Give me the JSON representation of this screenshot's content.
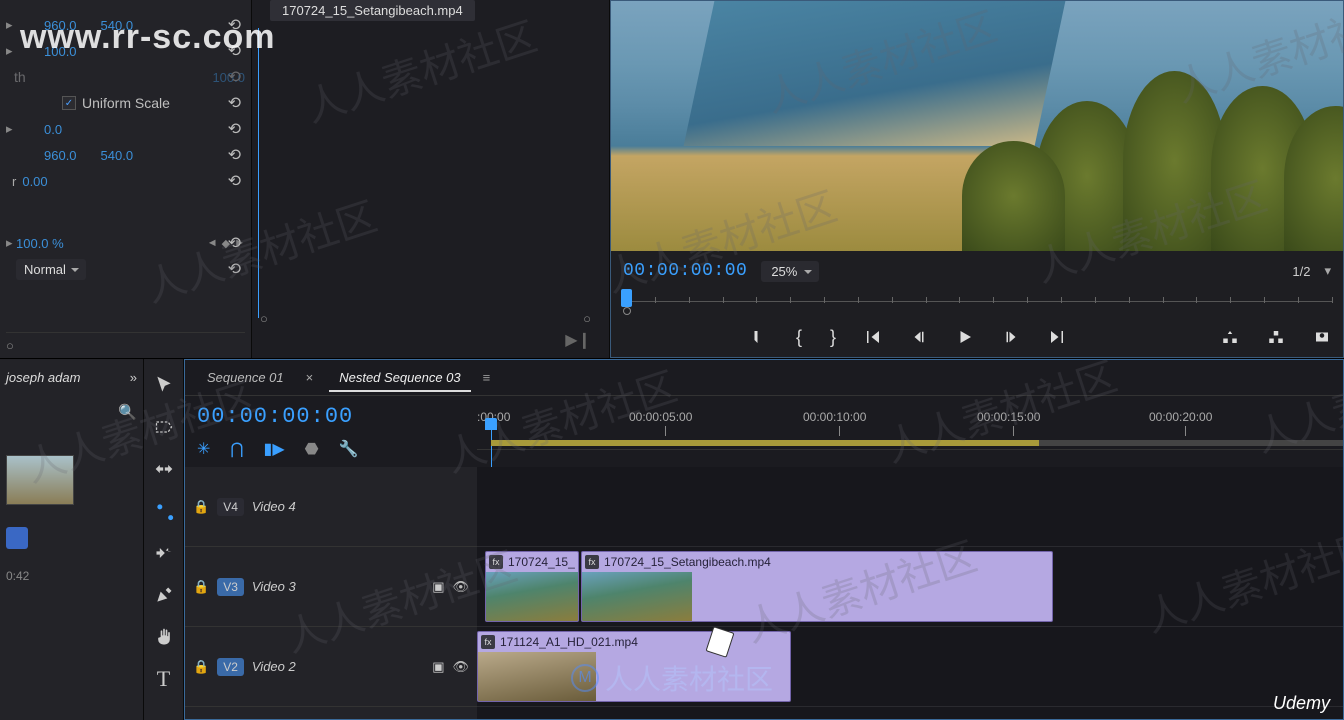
{
  "watermark": {
    "url": "www.rr-sc.com",
    "hanzi": "人人素材社区",
    "udemy": "Udemy"
  },
  "effect_controls": {
    "clip_tab": "170724_15_Setangibeach.mp4",
    "position": {
      "x": "960.0",
      "y": "540.0"
    },
    "scale": "100.0",
    "scale_width": "100.0",
    "uniform_label": "Uniform Scale",
    "rotation": "0.0",
    "anchor": {
      "x": "960.0",
      "y": "540.0"
    },
    "anti_flicker": "0.00",
    "opacity": "100.0 %",
    "blend": "Normal"
  },
  "program": {
    "timecode": "00:00:00:00",
    "zoom": "25%",
    "resolution": "1/2"
  },
  "project": {
    "tab": "joseph adam",
    "meta": "0:42"
  },
  "timeline": {
    "tabs": [
      "Sequence 01",
      "Nested Sequence 03"
    ],
    "active_tab": 1,
    "timecode": "00:00:00:00",
    "ruler": [
      ":00:00",
      "00:00:05:00",
      "00:00:10:00",
      "00:00:15:00",
      "00:00:20:00"
    ],
    "tracks": [
      {
        "tag": "V4",
        "name": "Video 4"
      },
      {
        "tag": "V3",
        "name": "Video 3"
      },
      {
        "tag": "V2",
        "name": "Video 2"
      }
    ],
    "clips": {
      "v3a": "170724_15_",
      "v3b": "170724_15_Setangibeach.mp4",
      "v2": "171124_A1_HD_021.mp4"
    }
  }
}
